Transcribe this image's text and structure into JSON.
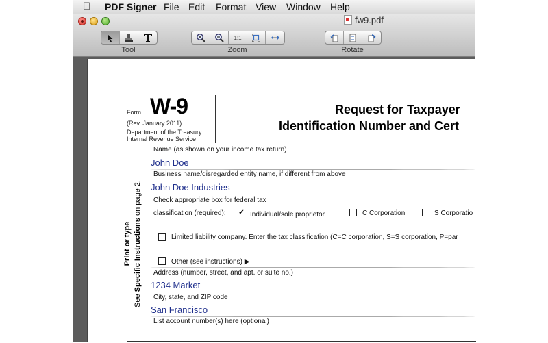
{
  "menubar": {
    "app_name": "PDF Signer",
    "items": [
      "File",
      "Edit",
      "Format",
      "View",
      "Window",
      "Help"
    ]
  },
  "window": {
    "title": "fw9.pdf"
  },
  "toolbar": {
    "tool_label": "Tool",
    "zoom_label": "Zoom",
    "rotate_label": "Rotate",
    "zoom_fit_label": "1:1"
  },
  "form": {
    "form_word": "Form",
    "form_number": "W-9",
    "revision": "(Rev. January 2011)",
    "dept_line1": "Department of the Treasury",
    "dept_line2": "Internal Revenue Service",
    "title_line1": "Request for Taxpayer",
    "title_line2": "Identification Number and Cert",
    "sidebar_line1": "Print or type",
    "sidebar_line2_pre": "See ",
    "sidebar_line2_bold": "Specific Instructions",
    "sidebar_line2_post": " on page 2.",
    "name_label": "Name (as shown on your income tax return)",
    "name_value": "John Doe",
    "business_label": "Business name/disregarded entity name, if different from above",
    "business_value": "John Doe Industries",
    "classification_label1": "Check appropriate box for federal tax",
    "classification_label2": "classification (required):",
    "opt_individual": "Individual/sole proprietor",
    "opt_individual_checked": true,
    "opt_c_corp": "C Corporation",
    "opt_s_corp": "S Corporatio",
    "opt_llc": "Limited liability company. Enter the tax classification (C=C corporation, S=S corporation, P=par",
    "opt_other": "Other (see instructions) ▶",
    "address_label": "Address (number, street, and apt. or suite no.)",
    "address_value": "1234 Market",
    "city_label": "City, state, and ZIP code",
    "city_value": "San Francisco",
    "account_label": "List account number(s) here (optional)",
    "checkmark": "✔"
  }
}
